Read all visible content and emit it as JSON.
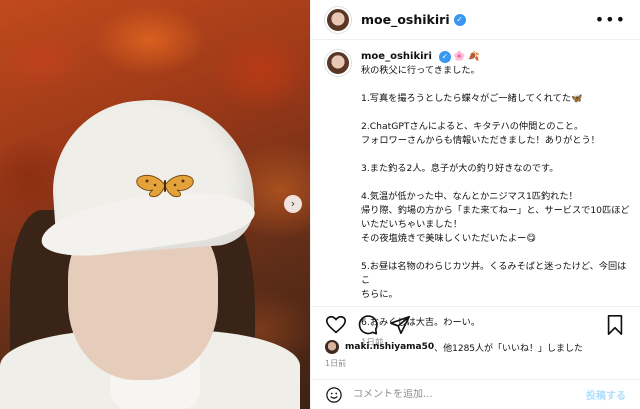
{
  "post": {
    "username": "moe_oshikiri",
    "caption_username": "moe_oshikiri",
    "caption_emoji": "🌸 🍂",
    "caption_lines": [
      "秋の秩父に行ってきました。",
      "",
      "1.写真を撮ろうとしたら蝶々がご一緒してくれてた🦋",
      "",
      "2.ChatGPTさんによると、キタテハの仲間とのこと。",
      "フォロワーさんからも情報いただきました！ありがとう！",
      "",
      "3.また釣る2人。息子が大の釣り好きなのです。",
      "",
      "4.気温が低かった中、なんとかニジマス1匹釣れた！",
      "帰り際、釣場の方から「また来てねー」と、サービスで10匹ほど",
      "いただいちゃいました！",
      "その夜塩焼きで美味しくいただいたよー😋",
      "",
      "5.お昼は名物のわらじカツ丼。くるみそばと迷ったけど、今回はこ",
      "ちらに。",
      "",
      "6.おみくじは大吉。わーい。"
    ],
    "caption_time": "1日前",
    "likes_text_user": "maki.nshiyama50",
    "likes_text_rest": "、他1285人が「いいね！」しました",
    "date": "1日前"
  },
  "comment": {
    "placeholder": "コメントを追加...",
    "post_label": "投稿する"
  },
  "icons": {
    "verified": "verified-badge-icon",
    "more": "more-options-icon",
    "like": "heart-icon",
    "comment": "comment-icon",
    "share": "share-icon",
    "save": "bookmark-icon",
    "emoji": "emoji-icon",
    "next": "chevron-right-icon"
  },
  "colors": {
    "verified": "#3897f0",
    "post_button": "#b2dffc",
    "muted_text": "#8e8e8e"
  }
}
